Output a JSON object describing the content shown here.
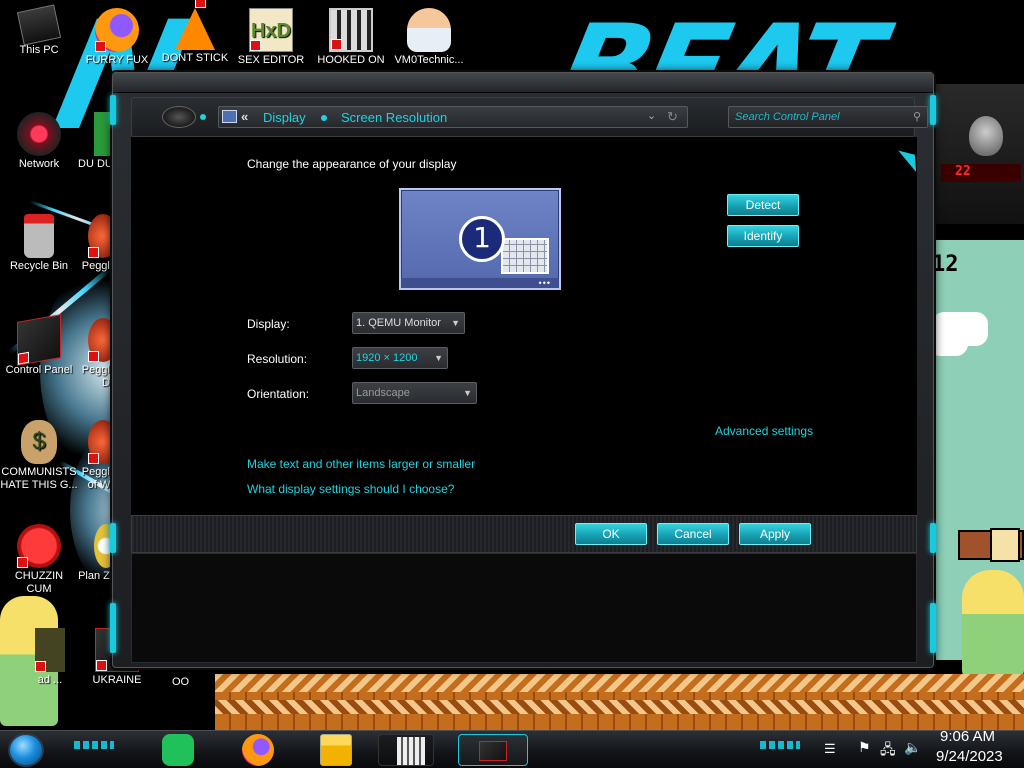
{
  "desktop": {
    "icons": [
      {
        "label": "This PC"
      },
      {
        "label": "FURRY FUX"
      },
      {
        "label": "DONT STICK"
      },
      {
        "label": "SEX EDITOR"
      },
      {
        "label": "HOOKED ON"
      },
      {
        "label": "VM0Technic..."
      },
      {
        "label": "Network"
      },
      {
        "label": "Recycle Bin"
      },
      {
        "label": "Control Panel"
      },
      {
        "label": "COMMUNISTS HATE THIS G..."
      },
      {
        "label": "CHUZZIN CUM"
      },
      {
        "label": "UKRAINE"
      },
      {
        "label": "DU DUM"
      },
      {
        "label": "Peggle"
      },
      {
        "label": "Peggle De"
      },
      {
        "label": "Peggle of Wa"
      },
      {
        "label": "Plan Zo"
      },
      {
        "label": "ad ..."
      },
      {
        "label": "OO"
      }
    ],
    "game_counter": "12",
    "alien_panel_text": "22"
  },
  "window": {
    "breadcrumb": {
      "chevron": "«",
      "items": [
        "Display",
        "Screen Resolution"
      ]
    },
    "search_placeholder": "Search Control Panel",
    "heading": "Change the appearance of your display",
    "monitor_number": "1",
    "buttons": {
      "detect": "Detect",
      "identify": "Identify",
      "ok": "OK",
      "cancel": "Cancel",
      "apply": "Apply"
    },
    "form": {
      "display": {
        "label": "Display:",
        "value": "1. QEMU Monitor"
      },
      "resolution": {
        "label": "Resolution:",
        "value": "1920 × 1200"
      },
      "orientation": {
        "label": "Orientation:",
        "value": "Landscape"
      }
    },
    "links": {
      "advanced": "Advanced settings",
      "text_size": "Make text and other items larger or smaller",
      "help": "What display settings should I choose?"
    }
  },
  "taskbar": {
    "pinned": [
      "start-orb",
      "notes-app",
      "firefox",
      "file-explorer",
      "game-app",
      "control-panel"
    ],
    "clock_time": "9:06 AM",
    "clock_date": "9/24/2023"
  },
  "colors": {
    "accent_cyan": "#1fd3e0",
    "button_cyan": "#16a2b4",
    "window_frame": "#1c1e21"
  }
}
